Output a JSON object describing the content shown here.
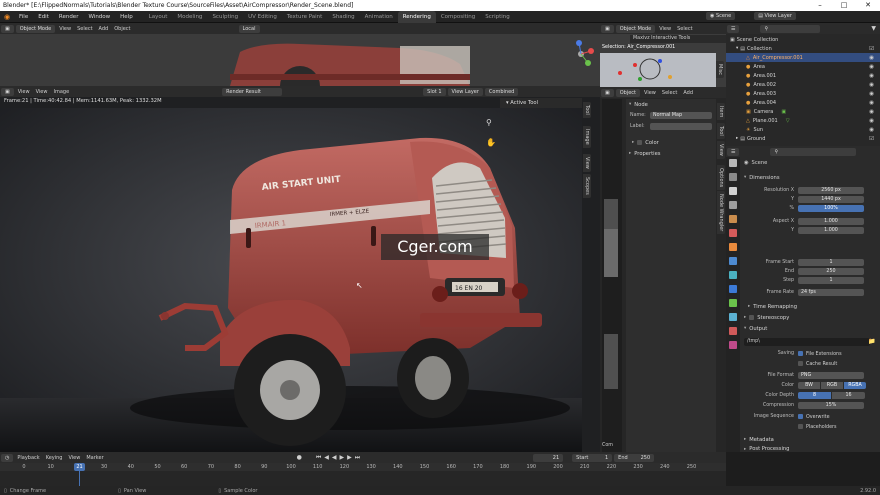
{
  "window": {
    "title": "Blender* [E:\\FlippedNormals\\Tutorials\\Blender Texture Course\\SourceFiles\\Asset\\AirCompressor\\Render_Scene.blend]"
  },
  "menu": [
    "File",
    "Edit",
    "Render",
    "Window",
    "Help"
  ],
  "workspaces": [
    "Layout",
    "Modeling",
    "Sculpting",
    "UV Editing",
    "Texture Paint",
    "Shading",
    "Animation",
    "Rendering",
    "Compositing",
    "Scripting"
  ],
  "active_workspace": "Rendering",
  "top_right": {
    "scene": "Scene",
    "view_layer": "View Layer"
  },
  "viewport": {
    "mode": "Object Mode",
    "menus": [
      "View",
      "Select",
      "Add",
      "Object"
    ],
    "orientation": "Local"
  },
  "render": {
    "menus": [
      "View",
      "View",
      "Image"
    ],
    "image_name": "Render Result",
    "slot": "Slot 1",
    "layer": "View Layer",
    "pass": "Combined",
    "info": "Frame:21 | Time:40:42.84 | Mem:1141.63M, Peak: 1332.32M",
    "tool_panel": "Active Tool",
    "side_tabs": [
      "Tool",
      "Image",
      "View",
      "Scopes"
    ],
    "plate_text": [
      "AIR START UNIT",
      "IRMER + ELZE",
      "IRMAIR 1",
      "16 EN 20"
    ]
  },
  "watermark": "Cger.com",
  "node_editor": {
    "mode": "Object Mode",
    "menus": [
      "View",
      "Select"
    ],
    "header2": {
      "object": "Object",
      "menus": [
        "View",
        "Select",
        "Add"
      ]
    },
    "panel_title": "Maxivz Interactive Tools",
    "selection_label": "Selection: Air_Compressor.001",
    "node_section": "Node",
    "name_label": "Name:",
    "name_value": "Normal Map",
    "label_label": "Label:",
    "color_label": "Color",
    "properties_label": "Properties",
    "tabs": [
      "Item",
      "Tool",
      "View",
      "Node Wrangler",
      "Options"
    ],
    "side_tabs_top": [
      "Misc",
      "Item",
      "Tool",
      "View"
    ],
    "bottom_text": "Com"
  },
  "outliner": {
    "root": "Scene Collection",
    "collection": "Collection",
    "items": [
      {
        "name": "Air_Compressor.001",
        "color": "#e88a3d",
        "selected": true
      },
      {
        "name": "Area",
        "color": "#e8a13d"
      },
      {
        "name": "Area.001",
        "color": "#e8a13d"
      },
      {
        "name": "Area.002",
        "color": "#e8a13d"
      },
      {
        "name": "Area.003",
        "color": "#e8a13d"
      },
      {
        "name": "Area.004",
        "color": "#e8a13d"
      },
      {
        "name": "Camera",
        "color": "#e8a13d"
      },
      {
        "name": "Plane.001",
        "color": "#e8a13d"
      },
      {
        "name": "Sun",
        "color": "#e8a13d"
      }
    ],
    "ground": "Ground"
  },
  "properties": {
    "scene": "Scene",
    "dimensions": "Dimensions",
    "resolution_x_label": "Resolution X",
    "resolution_x": "2560 px",
    "resolution_y_label": "Y",
    "resolution_y": "1440 px",
    "percent_label": "%",
    "percent": "100%",
    "aspect_x_label": "Aspect X",
    "aspect_x": "1.000",
    "aspect_y_label": "Y",
    "aspect_y": "1.000",
    "frame_start_label": "Frame Start",
    "frame_start": "1",
    "end_label": "End",
    "end": "250",
    "step_label": "Step",
    "step": "1",
    "frame_rate_label": "Frame Rate",
    "frame_rate": "24 fps",
    "time_remapping": "Time Remapping",
    "stereoscopy": "Stereoscopy",
    "output": "Output",
    "output_path": "/tmp\\",
    "saving_label": "Saving",
    "file_extensions": "File Extensions",
    "cache_result": "Cache Result",
    "file_format_label": "File Format",
    "file_format": "PNG",
    "color_label": "Color",
    "color_opts": [
      "BW",
      "RGB",
      "RGBA"
    ],
    "color_depth_label": "Color Depth",
    "depth_opts": [
      "8",
      "16"
    ],
    "compression_label": "Compression",
    "compression": "15%",
    "image_sequence_label": "Image Sequence",
    "overwrite": "Overwrite",
    "placeholders": "Placeholders",
    "metadata": "Metadata",
    "post_processing": "Post Processing"
  },
  "timeline": {
    "menus": [
      "Playback",
      "Keying",
      "View",
      "Marker"
    ],
    "current_frame": "21",
    "start_label": "Start",
    "start": "1",
    "end_label": "End",
    "end": "250",
    "ticks": [
      "0",
      "10",
      "21",
      "30",
      "40",
      "50",
      "60",
      "70",
      "80",
      "90",
      "100",
      "110",
      "120",
      "130",
      "140",
      "150",
      "160",
      "170",
      "180",
      "190",
      "200",
      "210",
      "220",
      "230",
      "240",
      "250"
    ]
  },
  "status": {
    "items": [
      "Change Frame",
      "Pan View",
      "Sample Color"
    ],
    "version": "2.92.0"
  }
}
